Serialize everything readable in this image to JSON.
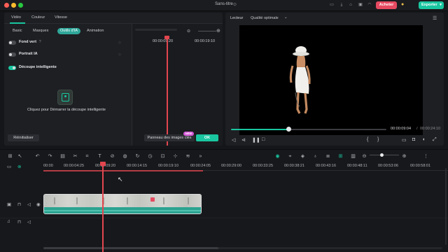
{
  "app": {
    "title": "Sans-titre",
    "buy_label": "Acheter",
    "export_label": "Exporter",
    "export_chevron": "▾"
  },
  "left_panel": {
    "tabs": [
      {
        "label": "Vidéo",
        "active": true
      },
      {
        "label": "Couleur",
        "active": false
      },
      {
        "label": "Vitesse",
        "active": false
      }
    ],
    "subtabs": [
      {
        "label": "Basic",
        "active": false
      },
      {
        "label": "Masques",
        "active": false
      },
      {
        "label": "Outils d'IA",
        "active": true
      },
      {
        "label": "Animation",
        "active": false
      }
    ],
    "options": [
      {
        "label": "Fond vert",
        "on": false,
        "has_help": true
      },
      {
        "label": "Portrait IA",
        "on": false,
        "has_help": false
      },
      {
        "label": "Découpe intelligente",
        "on": true,
        "has_help": false
      }
    ],
    "help_glyph": "?",
    "smart_cutout_hint": "Cliquez pour Démarrer la découpe intelligente",
    "mini_timeline": {
      "time_start": "00:00:09:20",
      "time_end": "00:00:19:10",
      "zoom_minus": "⊖",
      "zoom_plus": "⊕"
    },
    "reset_label": "Réinitialiser",
    "keyframe_label": "Panneau des images clés",
    "new_badge": "NEW",
    "ok_label": "OK"
  },
  "player": {
    "label": "Lecteur",
    "quality": "Qualité optimale",
    "quality_chevron": "⌄",
    "current_time": "00:00:09:04",
    "separator": "/",
    "total_time": "00:00:24:10",
    "progress_fraction": 0.37
  },
  "timeline": {
    "ruler_labels": [
      "00:00",
      "00:00:04:25",
      "00:00:09:20",
      "00:00:14:15",
      "00:00:19:10",
      "00:00:24:05",
      "00:00:29:00",
      "00:00:33:25",
      "00:00:38:21",
      "00:00:43:16",
      "00:00:48:11",
      "00:00:53:06",
      "00:00:58:01"
    ]
  },
  "colors": {
    "accent": "#19c6a0",
    "buy": "#e64a61",
    "playhead": "#e2464f",
    "new_badge": "#d65bd8",
    "clip_audio": "#2ba391"
  }
}
